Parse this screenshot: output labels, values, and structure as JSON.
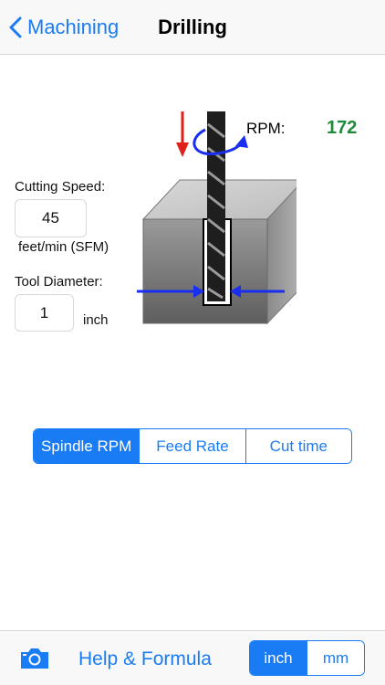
{
  "nav": {
    "back_label": "Machining",
    "title": "Drilling"
  },
  "inputs": {
    "cutting_speed": {
      "label": "Cutting Speed:",
      "value": "45",
      "unit": "feet/min (SFM)"
    },
    "tool_diameter": {
      "label": "Tool Diameter:",
      "value": "1",
      "unit": "inch"
    }
  },
  "result": {
    "label": "RPM:",
    "value": "172",
    "value_color": "#1e8a3c"
  },
  "mode_tabs": [
    {
      "label": "Spindle RPM",
      "selected": true
    },
    {
      "label": "Feed Rate",
      "selected": false
    },
    {
      "label": "Cut time",
      "selected": false
    }
  ],
  "toolbar": {
    "help_label": "Help & Formula",
    "units": [
      {
        "label": "inch",
        "selected": true
      },
      {
        "label": "mm",
        "selected": false
      }
    ]
  },
  "colors": {
    "accent": "#1a7cf5",
    "feed_arrow": "#e0201a",
    "diameter_arrow": "#1a2ef0"
  }
}
